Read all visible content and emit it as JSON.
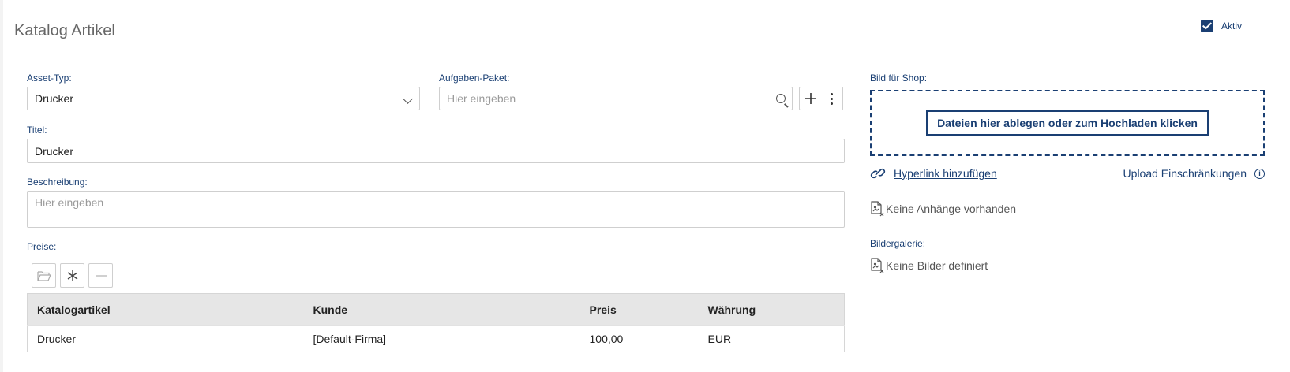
{
  "page": {
    "title": "Katalog Artikel"
  },
  "aktiv": {
    "label": "Aktiv",
    "checked": true
  },
  "asset_typ": {
    "label": "Asset-Typ:",
    "value": "Drucker"
  },
  "aufgaben_paket": {
    "label": "Aufgaben-Paket:",
    "placeholder": "Hier eingeben"
  },
  "titel": {
    "label": "Titel:",
    "value": "Drucker"
  },
  "beschreibung": {
    "label": "Beschreibung:",
    "placeholder": "Hier eingeben"
  },
  "preise": {
    "label": "Preise:",
    "columns": [
      "Katalogartikel",
      "Kunde",
      "Preis",
      "Währung"
    ],
    "rows": [
      [
        "Drucker",
        "[Default-Firma]",
        "100,00",
        "EUR"
      ]
    ]
  },
  "bild_shop": {
    "label": "Bild für Shop:",
    "dropzone_label": "Dateien hier ablegen oder zum Hochladen klicken",
    "hyperlink_label": "Hyperlink hinzufügen",
    "upload_restrictions_label": "Upload Einschränkungen",
    "no_attachments": "Keine Anhänge vorhanden"
  },
  "bildergalerie": {
    "label": "Bildergalerie:",
    "empty": "Keine Bilder definiert"
  },
  "colors": {
    "accent": "#1a3f73",
    "border": "#cfcfcf",
    "header_bg": "#e6e6e6"
  }
}
